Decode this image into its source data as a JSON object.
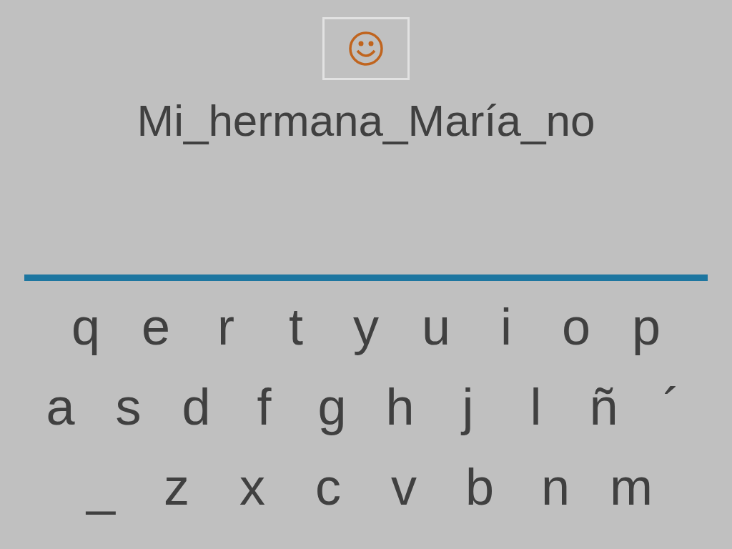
{
  "sentence": "Mi_hermana_María_no",
  "keyboard": {
    "rows": [
      [
        "q",
        "e",
        "r",
        "t",
        "y",
        "u",
        "i",
        "o",
        "p"
      ],
      [
        "a",
        "s",
        "d",
        "f",
        "g",
        "h",
        "j",
        "l",
        "ñ",
        "´"
      ],
      [
        "_",
        "z",
        "x",
        "c",
        "v",
        "b",
        "n",
        "m"
      ]
    ]
  }
}
